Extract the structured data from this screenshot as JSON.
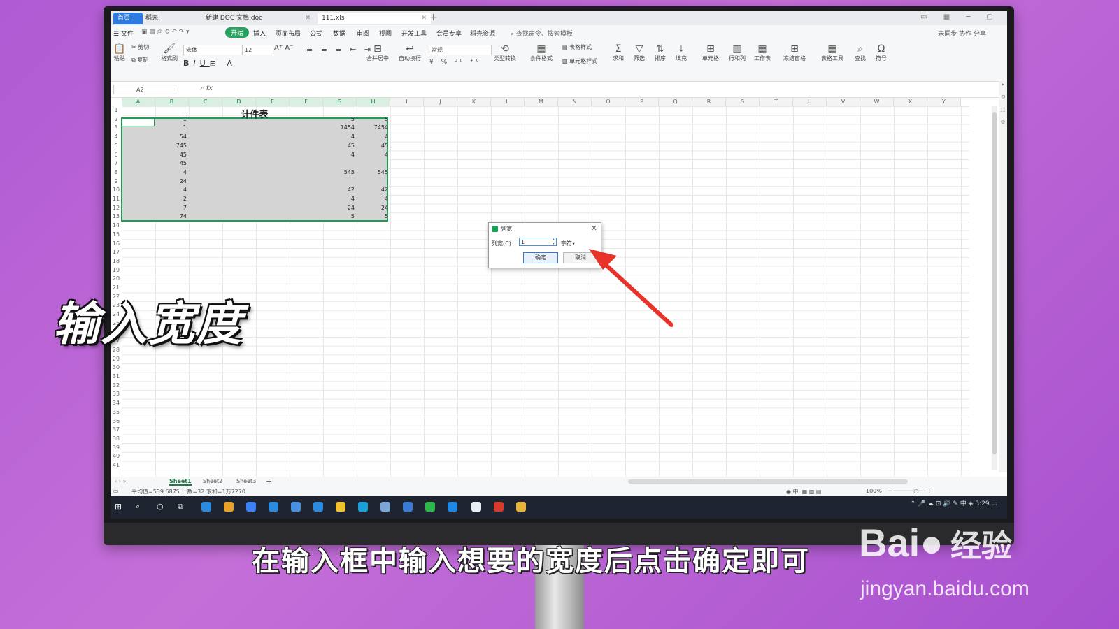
{
  "tabs": [
    {
      "label": "首页"
    },
    {
      "label": "稻壳"
    },
    {
      "label": "新建 DOC 文档.doc"
    },
    {
      "label": "111.xls"
    }
  ],
  "menu": [
    "文件",
    "开始",
    "插入",
    "页面布局",
    "公式",
    "数据",
    "审阅",
    "视图",
    "开发工具",
    "会员专享",
    "稻壳资源"
  ],
  "menu_active": "开始",
  "search_command": "查找命令、搜索模板",
  "menu_right": "未同步  协作  分享",
  "toolbar": {
    "cut": "剪切",
    "paste": "粘贴",
    "copy": "复制",
    "format_painter": "格式刷",
    "font": "宋体",
    "size": "12",
    "number_format": "常规",
    "merge": "合并居中",
    "wrap": "自动换行",
    "type_convert": "类型转换",
    "cond_format": "条件格式",
    "table_style": "表格样式",
    "cell_style": "单元格样式",
    "sum": "求和",
    "filter": "筛选",
    "sort": "排序",
    "fill": "填充",
    "cell": "单元格",
    "rowcol": "行和列",
    "worksheet": "工作表",
    "freeze": "冻结窗格",
    "table_tools": "表格工具",
    "find": "查找",
    "symbol": "符号"
  },
  "namebox": "A2",
  "columns": [
    "A",
    "B",
    "C",
    "D",
    "E",
    "F",
    "G",
    "H",
    "I",
    "J",
    "K",
    "L",
    "M",
    "N",
    "O",
    "P",
    "Q",
    "R",
    "S",
    "T",
    "U",
    "V",
    "W",
    "X",
    "Y"
  ],
  "sheet_title": "计件表",
  "rows": [
    {
      "b": "1",
      "g": "5",
      "h": "5"
    },
    {
      "b": "1",
      "g": "7454",
      "h": "7454"
    },
    {
      "b": "54",
      "g": "4",
      "h": "4"
    },
    {
      "b": "745",
      "g": "45",
      "h": "45"
    },
    {
      "b": "45",
      "g": "4",
      "h": "4"
    },
    {
      "b": "45",
      "g": "",
      "h": ""
    },
    {
      "b": "4",
      "g": "545",
      "h": "545"
    },
    {
      "b": "24",
      "g": "",
      "h": ""
    },
    {
      "b": "4",
      "g": "42",
      "h": "42"
    },
    {
      "b": "2",
      "g": "4",
      "h": "4"
    },
    {
      "b": "7",
      "g": "24",
      "h": "24"
    },
    {
      "b": "74",
      "g": "5",
      "h": "5"
    }
  ],
  "sheets": [
    "Sheet1",
    "Sheet2",
    "Sheet3"
  ],
  "status": "平均值=539.6875  计数=32  求和=1万7270",
  "zoom": "100%",
  "clock": "3:29",
  "dialog": {
    "title": "列宽",
    "label": "列宽(C):",
    "value": "1",
    "unit": "字符",
    "ok": "确定",
    "cancel": "取消"
  },
  "overlay_title": "输入宽度",
  "caption": "在输入框中输入想要的宽度后点击确定即可",
  "watermark": {
    "brand": "Bai",
    "cn": "经验",
    "url": "jingyan.baidu.com"
  },
  "colors": {
    "accent_green": "#1f9d55",
    "arrow_red": "#e8332b"
  }
}
